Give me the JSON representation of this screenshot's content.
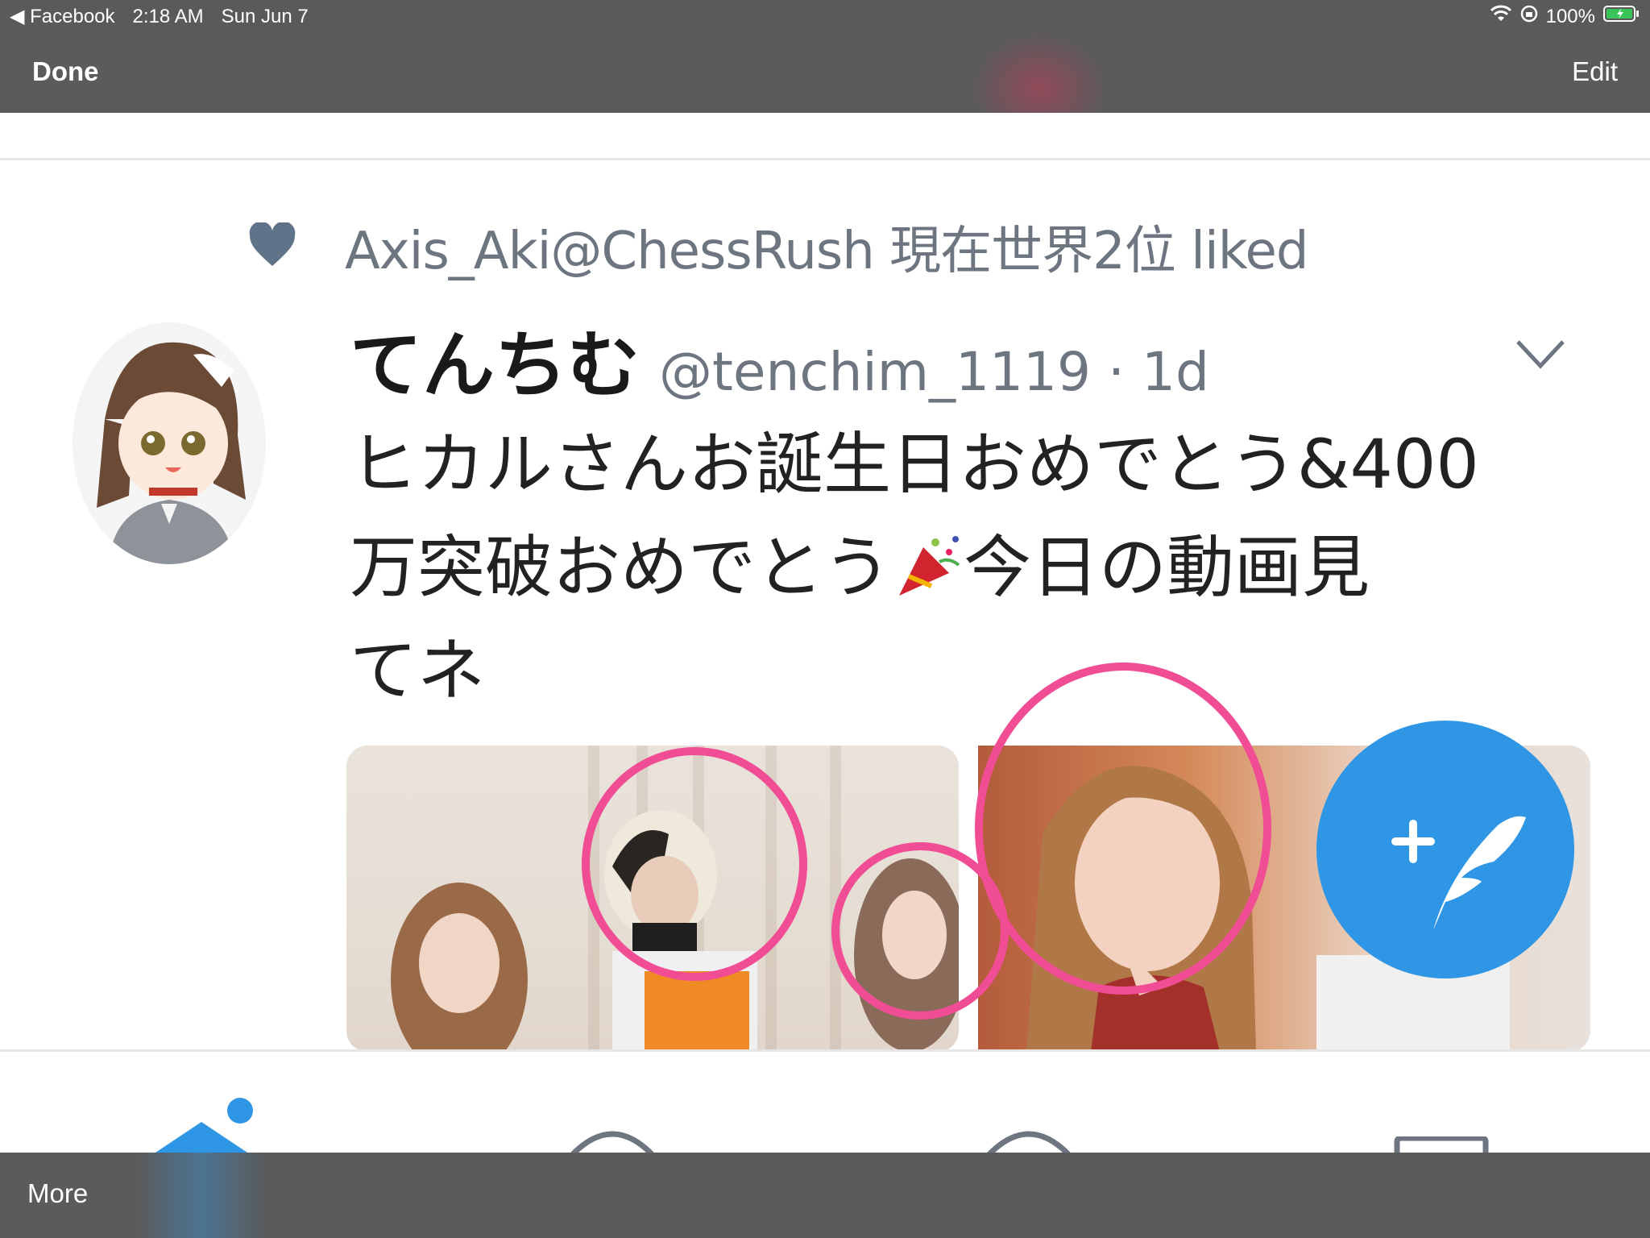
{
  "status_bar": {
    "back_app": "◀ Facebook",
    "time": "2:18 AM",
    "date": "Sun Jun 7",
    "battery": "100%"
  },
  "nav_bar": {
    "done_label": "Done",
    "edit_label": "Edit"
  },
  "tweet": {
    "liked_by": "Axis_Aki@ChessRush 現在世界2位 liked",
    "display_name": "てんちむ",
    "handle_time": "@tenchim_1119 · 1d",
    "text_line1": "ヒカルさんお誕生日おめでとう&400",
    "text_line2a": "万突破おめでとう",
    "text_line2b": "今日の動画見",
    "text_line3": "てネ"
  },
  "bottom_bar": {
    "more_label": "More"
  },
  "colors": {
    "accent_blue": "#2f96e6",
    "annotation_pink": "#f04d95",
    "muted_gray": "#6c7580",
    "overlay_bar": "#5b5b5b"
  },
  "icons": [
    "back-arrow-icon",
    "wifi-icon",
    "orientation-lock-icon",
    "battery-icon",
    "heart-icon",
    "chevron-down-icon",
    "party-popper-icon",
    "compose-tweet-icon",
    "home-icon",
    "search-icon",
    "notifications-icon",
    "messages-icon"
  ]
}
